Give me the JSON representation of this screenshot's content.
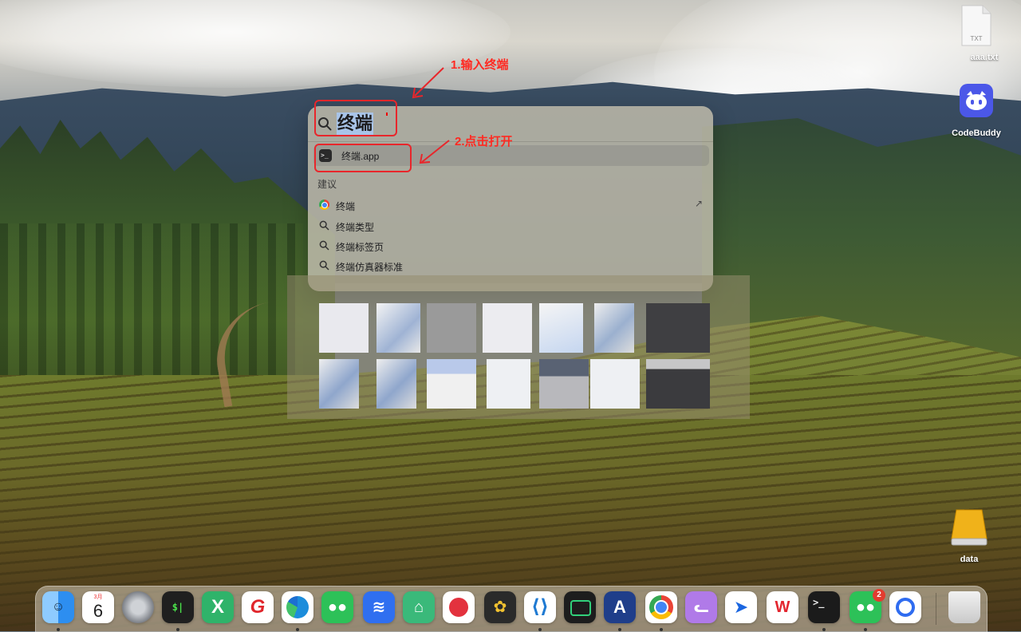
{
  "spotlight": {
    "query": "终端",
    "top_hit": {
      "label": "终端.app",
      "icon": "terminal-app-icon"
    },
    "suggestions_title": "建议",
    "suggestions": [
      {
        "label": "终端",
        "icon": "chrome-icon",
        "action": "↗"
      },
      {
        "label": "终端类型",
        "icon": "search-icon"
      },
      {
        "label": "终端标签页",
        "icon": "search-icon"
      },
      {
        "label": "终端仿真器标准",
        "icon": "search-icon"
      }
    ]
  },
  "annotations": {
    "step1": "1.输入终端",
    "step2": "2.点击打开",
    "color": "#e8262b"
  },
  "desktop_icons": [
    {
      "label": "aaa.txt",
      "icon": "txt-file-icon",
      "badge_text": "TXT"
    },
    {
      "label": "CodeBuddy",
      "icon": "codebuddy-app-icon"
    },
    {
      "label": "data",
      "icon": "external-drive-icon"
    }
  ],
  "dock": {
    "calendar": {
      "month": "3月",
      "day": "6"
    },
    "apps": [
      "finder-icon",
      "calendar-icon",
      "system-settings-icon",
      "terminal-green-icon",
      "excel-x-icon",
      "g-app-icon",
      "edge-icon",
      "wechat-icon",
      "lark-icon",
      "android-studio-icon",
      "red-app-icon",
      "yellow-app-icon",
      "vscode-icon",
      "green-terminal-icon",
      "shield-a-icon",
      "chrome-icon",
      "cat-app-icon",
      "feishu-icon",
      "wps-icon",
      "terminal-icon",
      "wechat-2-icon",
      "quark-icon",
      "trash-icon"
    ],
    "wechat_badge": "2"
  }
}
